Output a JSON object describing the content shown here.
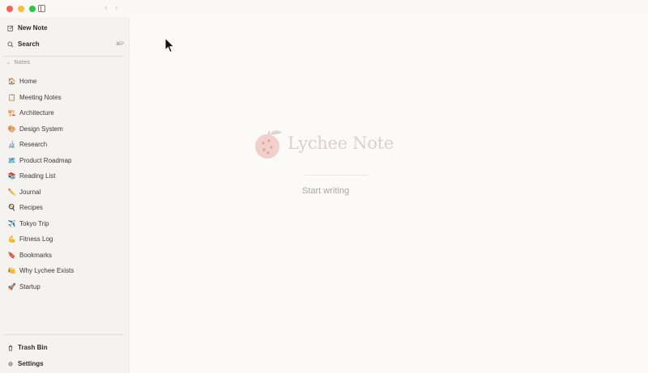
{
  "titlebar": {
    "back_arrow": "‹",
    "forward_arrow": "›"
  },
  "sidebar": {
    "new_note_label": "New Note",
    "search_label": "Search",
    "search_shortcut": "⌘P",
    "notes_section_label": "Notes",
    "notes": [
      {
        "emoji": "🏠",
        "label": "Home"
      },
      {
        "emoji": "📋",
        "label": "Meeting Notes"
      },
      {
        "emoji": "🏗️",
        "label": "Architecture"
      },
      {
        "emoji": "🎨",
        "label": "Design System"
      },
      {
        "emoji": "🔬",
        "label": "Research"
      },
      {
        "emoji": "🗺️",
        "label": "Product Roadmap"
      },
      {
        "emoji": "📚",
        "label": "Reading List"
      },
      {
        "emoji": "✏️",
        "label": "Journal"
      },
      {
        "emoji": "🍳",
        "label": "Recipes"
      },
      {
        "emoji": "✈️",
        "label": "Tokyo Trip"
      },
      {
        "emoji": "💪",
        "label": "Fitness Log"
      },
      {
        "emoji": "🔖",
        "label": "Bookmarks"
      },
      {
        "emoji": "🍋",
        "label": "Why Lychee Exists"
      },
      {
        "emoji": "🚀",
        "label": "Startup"
      }
    ],
    "trash_label": "Trash Bin",
    "settings_label": "Settings"
  },
  "main": {
    "logo_text": "Lychee Note",
    "placeholder": "Start writing"
  },
  "colors": {
    "traffic_red": "#ff5f57",
    "traffic_yellow": "#febc2e",
    "traffic_green": "#28c840",
    "logo_accent": "#e8a7a2",
    "sidebar_bg": "#f5f3ef",
    "content_bg": "#fbfaf8"
  }
}
